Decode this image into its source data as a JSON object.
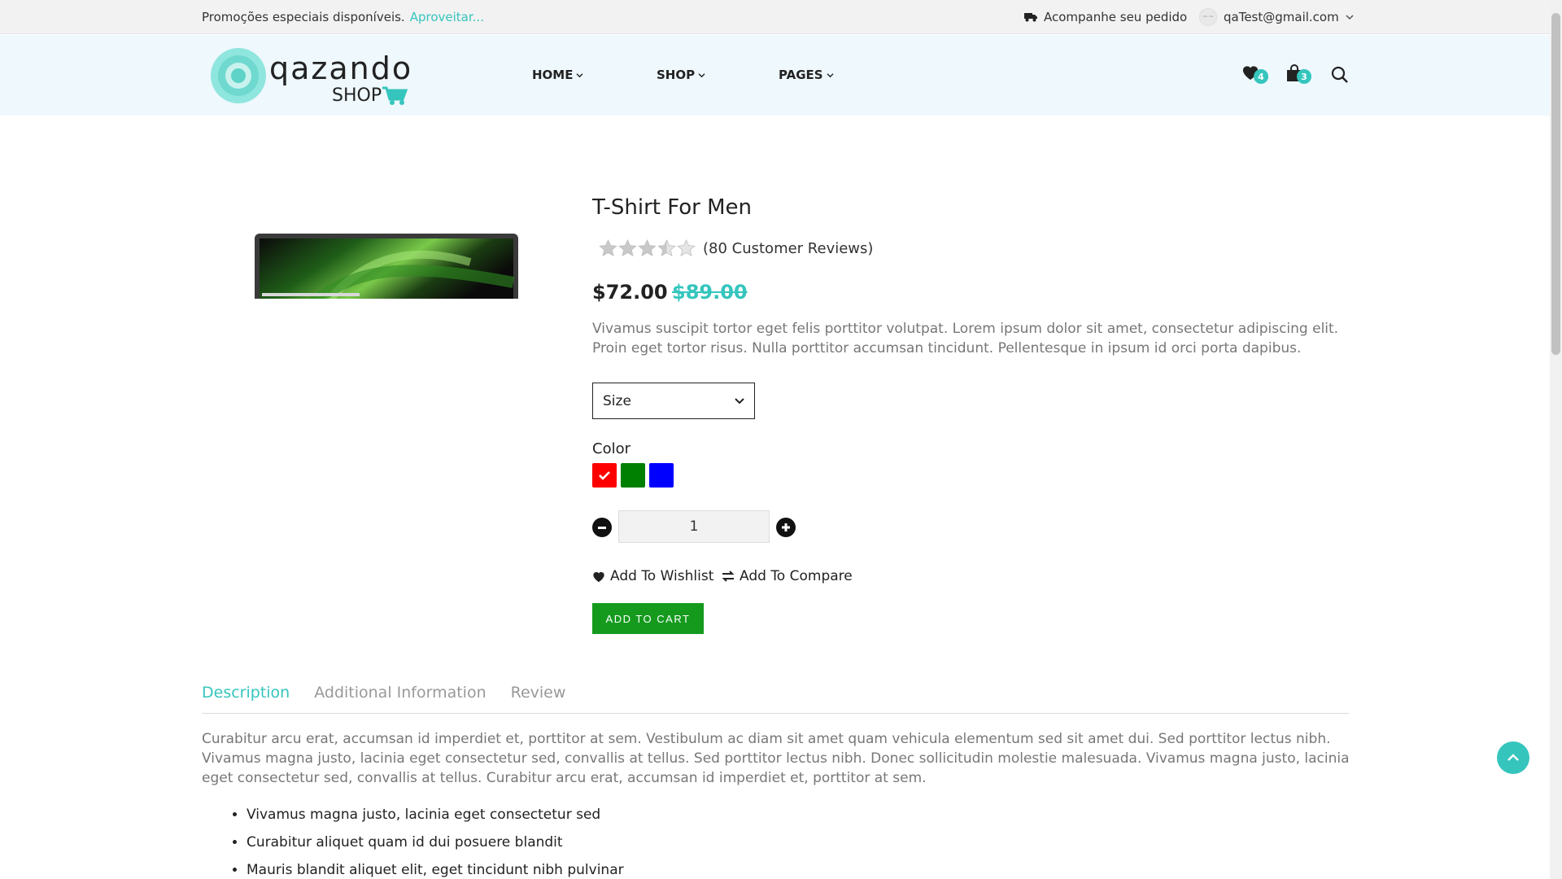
{
  "topbar": {
    "promo_text": "Promoções especiais disponíveis.",
    "promo_link": "Aproveitar...",
    "track_order": "Acompanhe seu pedido",
    "user_email": "qaTest@gmail.com"
  },
  "header": {
    "logo_alt": "Qazando Shop",
    "nav": [
      {
        "label": "HOME"
      },
      {
        "label": "SHOP"
      },
      {
        "label": "PAGES"
      }
    ],
    "wishlist_count": "4",
    "cart_count": "3"
  },
  "product": {
    "title": "T-Shirt For Men",
    "rating": 3.5,
    "rating_max": 5,
    "reviews": "(80 Customer Reviews)",
    "price": "$72.00",
    "old_price": "$89.00",
    "description": "Vivamus suscipit tortor eget felis porttitor volutpat. Lorem ipsum dolor sit amet, consectetur adipiscing elit. Proin eget tortor risus. Nulla porttitor accumsan tincidunt. Pellentesque in ipsum id orci porta dapibus.",
    "size_label": "Size",
    "color_label": "Color",
    "colors": [
      "#ff0000",
      "#008000",
      "#0000ff"
    ],
    "selected_color": "#ff0000",
    "quantity": "1",
    "wishlist_label": "Add To Wishlist",
    "compare_label": "Add To Compare",
    "add_to_cart": "ADD TO CART"
  },
  "tabs": {
    "items": [
      {
        "label": "Description",
        "active": true
      },
      {
        "label": "Additional Information",
        "active": false
      },
      {
        "label": "Review",
        "active": false
      }
    ],
    "description": "Curabitur arcu erat, accumsan id imperdiet et, porttitor at sem. Vestibulum ac diam sit amet quam vehicula elementum sed sit amet dui. Sed porttitor lectus nibh. Vivamus magna justo, lacinia eget consectetur sed, convallis at tellus. Sed porttitor lectus nibh. Donec sollicitudin molestie malesuada. Vivamus magna justo, lacinia eget consectetur sed, convallis at tellus. Curabitur arcu erat, accumsan id imperdiet et, porttitor at sem.",
    "bullets": [
      "Vivamus magna justo, lacinia eget consectetur sed",
      "Curabitur aliquet quam id dui posuere blandit",
      "Mauris blandit aliquet elit, eget tincidunt nibh pulvinar"
    ]
  },
  "colors": {
    "accent": "#35c5bd",
    "cart_button": "#159a1e",
    "header_bg": "#eef8fd"
  }
}
